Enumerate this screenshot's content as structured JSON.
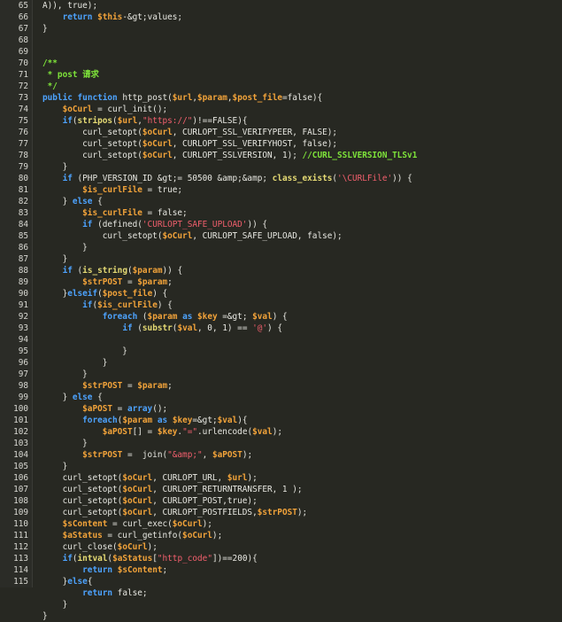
{
  "editor": {
    "lines": [
      {
        "n": "65",
        "t": [
          [
            "A)), true);",
            "pl"
          ]
        ]
      },
      {
        "n": "66",
        "t": [
          [
            "    ",
            ""
          ],
          [
            "return",
            "kw"
          ],
          [
            " ",
            ""
          ],
          [
            "$this",
            "var"
          ],
          [
            "-&gt;values;",
            "pl"
          ]
        ]
      },
      {
        "n": "67",
        "t": [
          [
            "}",
            "pl"
          ]
        ]
      },
      {
        "n": "68",
        "t": []
      },
      {
        "n": "69",
        "t": []
      },
      {
        "n": "70",
        "t": [
          [
            "/**",
            "cm"
          ]
        ]
      },
      {
        "n": "71",
        "t": [
          [
            " * post 请求",
            "cm"
          ]
        ]
      },
      {
        "n": "72",
        "t": [
          [
            " */",
            "cm"
          ]
        ]
      },
      {
        "n": "73",
        "t": [
          [
            "public",
            "kw"
          ],
          [
            " ",
            ""
          ],
          [
            "function",
            "kw"
          ],
          [
            " http_post(",
            "pl"
          ],
          [
            "$url",
            "var"
          ],
          [
            ",",
            "pl"
          ],
          [
            "$param",
            "var"
          ],
          [
            ",",
            "pl"
          ],
          [
            "$post_file",
            "var"
          ],
          [
            "=false){",
            "pl"
          ]
        ]
      },
      {
        "n": "74",
        "t": [
          [
            "    ",
            ""
          ],
          [
            "$oCurl",
            "var"
          ],
          [
            " = curl_init();",
            "pl"
          ]
        ]
      },
      {
        "n": "75",
        "t": [
          [
            "    ",
            ""
          ],
          [
            "if",
            "kw"
          ],
          [
            "(",
            "pl"
          ],
          [
            "stripos",
            "fn"
          ],
          [
            "(",
            "pl"
          ],
          [
            "$url",
            "var"
          ],
          [
            ",",
            "pl"
          ],
          [
            "\"https://\"",
            "str"
          ],
          [
            ")!==FALSE){",
            "pl"
          ]
        ]
      },
      {
        "n": "76",
        "t": [
          [
            "        curl_setopt(",
            "pl"
          ],
          [
            "$oCurl",
            "var"
          ],
          [
            ", CURLOPT_SSL_VERIFYPEER, FALSE);",
            "pl"
          ]
        ]
      },
      {
        "n": "77",
        "t": [
          [
            "        curl_setopt(",
            "pl"
          ],
          [
            "$oCurl",
            "var"
          ],
          [
            ", CURLOPT_SSL_VERIFYHOST, false);",
            "pl"
          ]
        ]
      },
      {
        "n": "78",
        "t": [
          [
            "        curl_setopt(",
            "pl"
          ],
          [
            "$oCurl",
            "var"
          ],
          [
            ", CURLOPT_SSLVERSION, 1); ",
            "pl"
          ],
          [
            "//CURL_SSLVERSION_TLSv1",
            "cm"
          ]
        ]
      },
      {
        "n": "79",
        "t": [
          [
            "    }",
            "pl"
          ]
        ]
      },
      {
        "n": "80",
        "t": [
          [
            "    ",
            ""
          ],
          [
            "if",
            "kw"
          ],
          [
            " (PHP_VERSION_ID &gt;= 50500 &amp;&amp; ",
            "pl"
          ],
          [
            "class_exists",
            "fn"
          ],
          [
            "(",
            "pl"
          ],
          [
            "'\\CURLFile'",
            "str"
          ],
          [
            ")) {",
            "pl"
          ]
        ]
      },
      {
        "n": "81",
        "t": [
          [
            "        ",
            ""
          ],
          [
            "$is_curlFile",
            "var"
          ],
          [
            " = true;",
            "pl"
          ]
        ]
      },
      {
        "n": "82",
        "t": [
          [
            "    } ",
            "pl"
          ],
          [
            "else",
            "kw"
          ],
          [
            " {",
            "pl"
          ]
        ]
      },
      {
        "n": "83",
        "t": [
          [
            "        ",
            ""
          ],
          [
            "$is_curlFile",
            "var"
          ],
          [
            " = false;",
            "pl"
          ]
        ]
      },
      {
        "n": "84",
        "t": [
          [
            "        ",
            ""
          ],
          [
            "if",
            "kw"
          ],
          [
            " (defined(",
            "pl"
          ],
          [
            "'CURLOPT_SAFE_UPLOAD'",
            "str"
          ],
          [
            ")) {",
            "pl"
          ]
        ]
      },
      {
        "n": "85",
        "t": [
          [
            "            curl_setopt(",
            "pl"
          ],
          [
            "$oCurl",
            "var"
          ],
          [
            ", CURLOPT_SAFE_UPLOAD, false);",
            "pl"
          ]
        ]
      },
      {
        "n": "86",
        "t": [
          [
            "        }",
            "pl"
          ]
        ]
      },
      {
        "n": "87",
        "t": [
          [
            "    }",
            "pl"
          ]
        ]
      },
      {
        "n": "88",
        "t": [
          [
            "    ",
            ""
          ],
          [
            "if",
            "kw"
          ],
          [
            " (",
            "pl"
          ],
          [
            "is_string",
            "fn"
          ],
          [
            "(",
            "pl"
          ],
          [
            "$param",
            "var"
          ],
          [
            ")) {",
            "pl"
          ]
        ]
      },
      {
        "n": "89",
        "t": [
          [
            "        ",
            ""
          ],
          [
            "$strPOST",
            "var"
          ],
          [
            " = ",
            "pl"
          ],
          [
            "$param",
            "var"
          ],
          [
            ";",
            "pl"
          ]
        ]
      },
      {
        "n": "90",
        "t": [
          [
            "    }",
            "pl"
          ],
          [
            "elseif",
            "kw"
          ],
          [
            "(",
            "pl"
          ],
          [
            "$post_file",
            "var"
          ],
          [
            ") {",
            "pl"
          ]
        ]
      },
      {
        "n": "91",
        "t": [
          [
            "        ",
            ""
          ],
          [
            "if",
            "kw"
          ],
          [
            "(",
            "pl"
          ],
          [
            "$is_curlFile",
            "var"
          ],
          [
            ") {",
            "pl"
          ]
        ]
      },
      {
        "n": "92",
        "t": [
          [
            "            ",
            ""
          ],
          [
            "foreach",
            "kw"
          ],
          [
            " (",
            "pl"
          ],
          [
            "$param",
            "var"
          ],
          [
            " ",
            ""
          ],
          [
            "as",
            "kw"
          ],
          [
            " ",
            ""
          ],
          [
            "$key",
            "var"
          ],
          [
            " =&gt; ",
            "pl"
          ],
          [
            "$val",
            "var"
          ],
          [
            ") {",
            "pl"
          ]
        ]
      },
      {
        "n": "93",
        "t": [
          [
            "                ",
            ""
          ],
          [
            "if",
            "kw"
          ],
          [
            " (",
            "pl"
          ],
          [
            "substr",
            "fn"
          ],
          [
            "(",
            "pl"
          ],
          [
            "$val",
            "var"
          ],
          [
            ", 0, 1) == ",
            "pl"
          ],
          [
            "'@'",
            "str"
          ],
          [
            ") {",
            "pl"
          ]
        ]
      },
      {
        "n": "94",
        "t": []
      },
      {
        "n": "95",
        "t": [
          [
            "                }",
            "pl"
          ]
        ]
      },
      {
        "n": "96",
        "t": [
          [
            "            }",
            "pl"
          ]
        ]
      },
      {
        "n": "97",
        "t": [
          [
            "        }",
            "pl"
          ]
        ]
      },
      {
        "n": "98",
        "t": [
          [
            "        ",
            ""
          ],
          [
            "$strPOST",
            "var"
          ],
          [
            " = ",
            "pl"
          ],
          [
            "$param",
            "var"
          ],
          [
            ";",
            "pl"
          ]
        ]
      },
      {
        "n": "99",
        "t": [
          [
            "    } ",
            "pl"
          ],
          [
            "else",
            "kw"
          ],
          [
            " {",
            "pl"
          ]
        ]
      },
      {
        "n": "100",
        "t": [
          [
            "        ",
            ""
          ],
          [
            "$aPOST",
            "var"
          ],
          [
            " = ",
            "pl"
          ],
          [
            "array",
            "kw"
          ],
          [
            "();",
            "pl"
          ]
        ]
      },
      {
        "n": "101",
        "t": [
          [
            "        ",
            ""
          ],
          [
            "foreach",
            "kw"
          ],
          [
            "(",
            "pl"
          ],
          [
            "$param",
            "var"
          ],
          [
            " ",
            ""
          ],
          [
            "as",
            "kw"
          ],
          [
            " ",
            ""
          ],
          [
            "$key",
            "var"
          ],
          [
            "=&gt;",
            "pl"
          ],
          [
            "$val",
            "var"
          ],
          [
            "){",
            "pl"
          ]
        ]
      },
      {
        "n": "102",
        "t": [
          [
            "            ",
            ""
          ],
          [
            "$aPOST",
            "var"
          ],
          [
            "[] = ",
            "pl"
          ],
          [
            "$key",
            "var"
          ],
          [
            ".",
            "pl"
          ],
          [
            "\"=\"",
            "str"
          ],
          [
            ".urlencode(",
            "pl"
          ],
          [
            "$val",
            "var"
          ],
          [
            ");",
            "pl"
          ]
        ]
      },
      {
        "n": "103",
        "t": [
          [
            "        }",
            "pl"
          ]
        ]
      },
      {
        "n": "104",
        "t": [
          [
            "        ",
            ""
          ],
          [
            "$strPOST",
            "var"
          ],
          [
            " =  join(",
            "pl"
          ],
          [
            "\"&amp;\"",
            "str"
          ],
          [
            ", ",
            "pl"
          ],
          [
            "$aPOST",
            "var"
          ],
          [
            ");",
            "pl"
          ]
        ]
      },
      {
        "n": "105",
        "t": [
          [
            "    }",
            "pl"
          ]
        ]
      },
      {
        "n": "106",
        "t": [
          [
            "    curl_setopt(",
            "pl"
          ],
          [
            "$oCurl",
            "var"
          ],
          [
            ", CURLOPT_URL, ",
            "pl"
          ],
          [
            "$url",
            "var"
          ],
          [
            ");",
            "pl"
          ]
        ]
      },
      {
        "n": "107",
        "t": [
          [
            "    curl_setopt(",
            "pl"
          ],
          [
            "$oCurl",
            "var"
          ],
          [
            ", CURLOPT_RETURNTRANSFER, 1 );",
            "pl"
          ]
        ]
      },
      {
        "n": "108",
        "t": [
          [
            "    curl_setopt(",
            "pl"
          ],
          [
            "$oCurl",
            "var"
          ],
          [
            ", CURLOPT_POST,true);",
            "pl"
          ]
        ]
      },
      {
        "n": "109",
        "t": [
          [
            "    curl_setopt(",
            "pl"
          ],
          [
            "$oCurl",
            "var"
          ],
          [
            ", CURLOPT_POSTFIELDS,",
            "pl"
          ],
          [
            "$strPOST",
            "var"
          ],
          [
            ");",
            "pl"
          ]
        ]
      },
      {
        "n": "110",
        "t": [
          [
            "    ",
            ""
          ],
          [
            "$sContent",
            "var"
          ],
          [
            " = curl_exec(",
            "pl"
          ],
          [
            "$oCurl",
            "var"
          ],
          [
            ");",
            "pl"
          ]
        ]
      },
      {
        "n": "111",
        "t": [
          [
            "    ",
            ""
          ],
          [
            "$aStatus",
            "var"
          ],
          [
            " = curl_getinfo(",
            "pl"
          ],
          [
            "$oCurl",
            "var"
          ],
          [
            ");",
            "pl"
          ]
        ]
      },
      {
        "n": "112",
        "t": [
          [
            "    curl_close(",
            "pl"
          ],
          [
            "$oCurl",
            "var"
          ],
          [
            ");",
            "pl"
          ]
        ]
      },
      {
        "n": "113",
        "t": [
          [
            "    ",
            ""
          ],
          [
            "if",
            "kw"
          ],
          [
            "(",
            "pl"
          ],
          [
            "intval",
            "fn"
          ],
          [
            "(",
            "pl"
          ],
          [
            "$aStatus",
            "var"
          ],
          [
            "[",
            "pl"
          ],
          [
            "\"http_code\"",
            "str"
          ],
          [
            "])==200){",
            "pl"
          ]
        ]
      },
      {
        "n": "114",
        "t": [
          [
            "        ",
            ""
          ],
          [
            "return",
            "kw"
          ],
          [
            " ",
            ""
          ],
          [
            "$sContent",
            "var"
          ],
          [
            ";",
            "pl"
          ]
        ]
      },
      {
        "n": "115",
        "t": [
          [
            "    }",
            "pl"
          ],
          [
            "else",
            "kw"
          ],
          [
            "{",
            "pl"
          ]
        ]
      },
      {
        "n": "",
        "t": [
          [
            "        ",
            ""
          ],
          [
            "return",
            "kw"
          ],
          [
            " false;",
            "pl"
          ]
        ]
      },
      {
        "n": "",
        "t": [
          [
            "    }",
            "pl"
          ]
        ]
      },
      {
        "n": "",
        "t": [
          [
            "}",
            "pl"
          ]
        ]
      }
    ]
  }
}
